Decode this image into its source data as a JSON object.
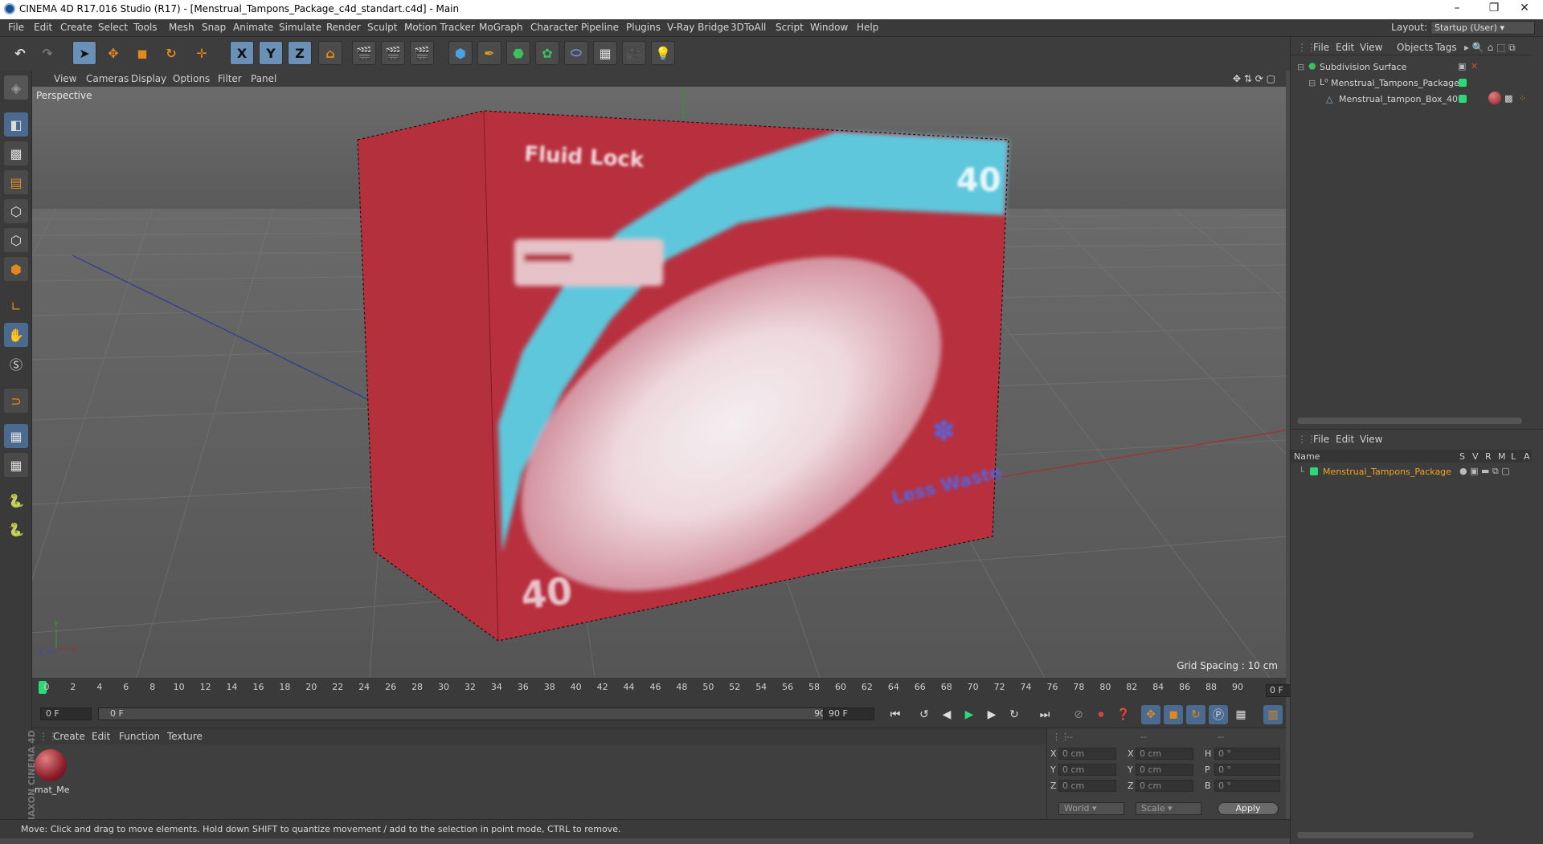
{
  "window": {
    "title": "CINEMA 4D R17.016 Studio (R17) - [Menstrual_Tampons_Package_c4d_standart.c4d] - Main",
    "minimize": "–",
    "restore": "❐",
    "close": "✕"
  },
  "menubar": {
    "items": [
      "File",
      "Edit",
      "Create",
      "Select",
      "Tools",
      "Mesh",
      "Snap",
      "Animate",
      "Simulate",
      "Render",
      "Sculpt",
      "Motion Tracker",
      "MoGraph",
      "Character",
      "Pipeline",
      "Plugins",
      "V-Ray Bridge",
      "3DToAll",
      "Script",
      "Window",
      "Help"
    ],
    "layout_label": "Layout:",
    "layout_value": "Startup (User)"
  },
  "toolbar": {
    "axis_x": "X",
    "axis_y": "Y",
    "axis_z": "Z"
  },
  "viewport": {
    "menu": [
      "View",
      "Cameras",
      "Display",
      "Options",
      "Filter",
      "Panel"
    ],
    "camera_label": "Perspective",
    "grid_spacing": "Grid Spacing : 10 cm",
    "box_text": {
      "brand": "Fluid Lock",
      "count_top": "40",
      "count_bottom": "40",
      "side_text": "Less Waste"
    }
  },
  "timeline": {
    "ticks": [
      "0",
      "2",
      "4",
      "6",
      "8",
      "10",
      "12",
      "14",
      "16",
      "18",
      "20",
      "22",
      "24",
      "26",
      "28",
      "30",
      "32",
      "34",
      "36",
      "38",
      "40",
      "42",
      "44",
      "46",
      "48",
      "50",
      "52",
      "54",
      "56",
      "58",
      "60",
      "62",
      "64",
      "66",
      "68",
      "70",
      "72",
      "74",
      "76",
      "78",
      "80",
      "82",
      "84",
      "86",
      "88",
      "90"
    ],
    "current_frame": "0 F"
  },
  "animation": {
    "start": "0 F",
    "range_start": "0 F",
    "range_end": "90 F",
    "end": "90 F"
  },
  "material_panel": {
    "menu": [
      "Create",
      "Edit",
      "Function",
      "Texture"
    ],
    "material_name": "mat_Me"
  },
  "coordinates": {
    "header": [
      "--",
      "--",
      "--"
    ],
    "pos": [
      {
        "label": "X",
        "value": "0 cm"
      },
      {
        "label": "Y",
        "value": "0 cm"
      },
      {
        "label": "Z",
        "value": "0 cm"
      }
    ],
    "size": [
      {
        "label": "X",
        "value": "0 cm"
      },
      {
        "label": "Y",
        "value": "0 cm"
      },
      {
        "label": "Z",
        "value": "0 cm"
      }
    ],
    "rot": [
      {
        "label": "H",
        "value": "0 °"
      },
      {
        "label": "P",
        "value": "0 °"
      },
      {
        "label": "B",
        "value": "0 °"
      }
    ],
    "mode_world": "World",
    "mode_scale": "Scale",
    "apply": "Apply"
  },
  "maxon_logo": "MAXON CINEMA 4D",
  "status": "Move: Click and drag to move elements. Hold down SHIFT to quantize movement / add to the selection in point mode, CTRL to remove.",
  "objects_panel": {
    "menu": [
      "File",
      "Edit",
      "View",
      "Objects",
      "Tags"
    ],
    "items": [
      {
        "name": "Subdivision Surface"
      },
      {
        "name": "Menstrual_Tampons_Package"
      },
      {
        "name": "Menstrual_tampon_Box_40"
      }
    ]
  },
  "layers_panel": {
    "menu": [
      "File",
      "Edit",
      "View"
    ],
    "columns": [
      "Name",
      "S",
      "V",
      "R",
      "M",
      "L",
      "A"
    ],
    "row": "Menstrual_Tampons_Package"
  },
  "colors": {
    "accent_orange": "#f0a41e",
    "object_green": "#2dd879",
    "box_red": "#b8303e",
    "box_cyan": "#5ec7dc"
  }
}
